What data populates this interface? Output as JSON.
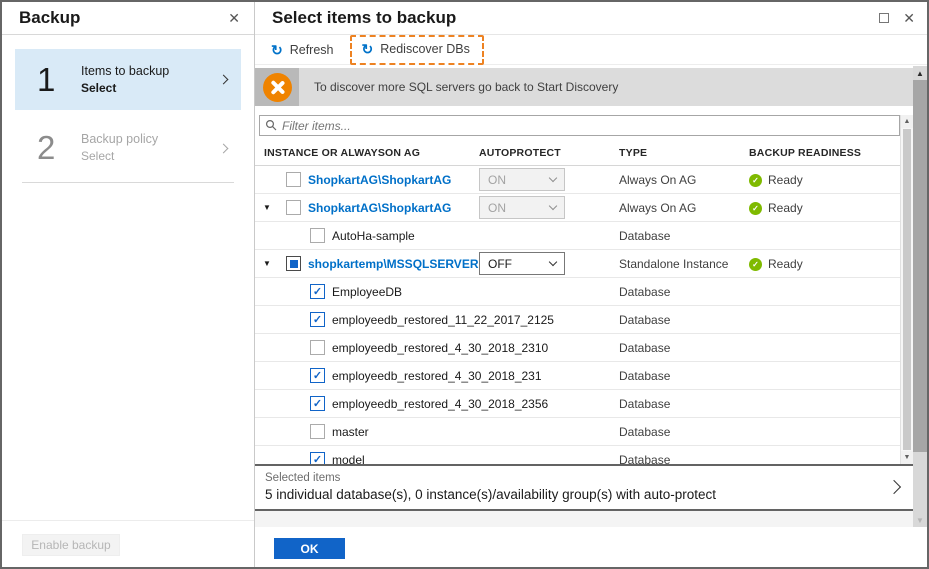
{
  "left_panel": {
    "title": "Backup",
    "steps": [
      {
        "number": "1",
        "label": "Items to backup",
        "sublabel": "Select",
        "active": true
      },
      {
        "number": "2",
        "label": "Backup policy",
        "sublabel": "Select",
        "active": false
      }
    ],
    "enable_backup_label": "Enable backup"
  },
  "right_panel": {
    "title": "Select items to backup",
    "toolbar": {
      "refresh_label": "Refresh",
      "rediscover_label": "Rediscover DBs",
      "rediscover_highlighted": true
    },
    "banner": {
      "text": "To discover more SQL servers go back to Start Discovery"
    },
    "filter": {
      "placeholder": "Filter items..."
    },
    "table": {
      "columns": [
        "INSTANCE OR ALWAYSON AG",
        "AUTOPROTECT",
        "TYPE",
        "BACKUP READINESS"
      ],
      "rows": [
        {
          "name": "ShopkartAG\\ShopkartAG",
          "expand": "none",
          "level": 1,
          "link": true,
          "checkbox": "unchecked",
          "autoprotect": {
            "value": "ON",
            "enabled": false
          },
          "type": "Always On AG",
          "readiness": "Ready"
        },
        {
          "name": "ShopkartAG\\ShopkartAG",
          "expand": "down",
          "level": 1,
          "link": true,
          "checkbox": "unchecked",
          "autoprotect": {
            "value": "ON",
            "enabled": false
          },
          "type": "Always On AG",
          "readiness": "Ready"
        },
        {
          "name": "AutoHa-sample",
          "expand": "none",
          "level": 2,
          "link": false,
          "checkbox": "unchecked",
          "autoprotect": null,
          "type": "Database",
          "readiness": null
        },
        {
          "name": "shopkartemp\\MSSQLSERVER",
          "expand": "down",
          "level": 1,
          "link": true,
          "checkbox": "indeterminate",
          "autoprotect": {
            "value": "OFF",
            "enabled": true
          },
          "type": "Standalone Instance",
          "readiness": "Ready"
        },
        {
          "name": "EmployeeDB",
          "expand": "none",
          "level": 2,
          "link": false,
          "checkbox": "checked",
          "autoprotect": null,
          "type": "Database",
          "readiness": null
        },
        {
          "name": "employeedb_restored_11_22_2017_2125",
          "expand": "none",
          "level": 2,
          "link": false,
          "checkbox": "checked",
          "autoprotect": null,
          "type": "Database",
          "readiness": null
        },
        {
          "name": "employeedb_restored_4_30_2018_2310",
          "expand": "none",
          "level": 2,
          "link": false,
          "checkbox": "unchecked",
          "autoprotect": null,
          "type": "Database",
          "readiness": null
        },
        {
          "name": "employeedb_restored_4_30_2018_231",
          "expand": "none",
          "level": 2,
          "link": false,
          "checkbox": "checked",
          "autoprotect": null,
          "type": "Database",
          "readiness": null
        },
        {
          "name": "employeedb_restored_4_30_2018_2356",
          "expand": "none",
          "level": 2,
          "link": false,
          "checkbox": "checked",
          "autoprotect": null,
          "type": "Database",
          "readiness": null
        },
        {
          "name": "master",
          "expand": "none",
          "level": 2,
          "link": false,
          "checkbox": "unchecked",
          "autoprotect": null,
          "type": "Database",
          "readiness": null
        },
        {
          "name": "model",
          "expand": "none",
          "level": 2,
          "link": false,
          "checkbox": "checked",
          "autoprotect": null,
          "type": "Database",
          "readiness": null
        }
      ]
    },
    "selected_items": {
      "label": "Selected items",
      "value": "5 individual database(s), 0 instance(s)/availability group(s) with auto-protect"
    },
    "ok_label": "OK"
  },
  "icons": {
    "close": "✕",
    "refresh": "↻",
    "expand_down": "▼",
    "ready_check": "✓",
    "scroll_up": "▲",
    "scroll_down": "▼"
  },
  "colors": {
    "accent_blue": "#0072c9",
    "link_blue": "#0070c8",
    "ok_button_blue": "#1164c8",
    "ready_green": "#7fba00",
    "warning_orange": "#ef8300",
    "highlight_dashed_orange": "#ed8222",
    "step_active_bg": "#d9eaf7"
  }
}
